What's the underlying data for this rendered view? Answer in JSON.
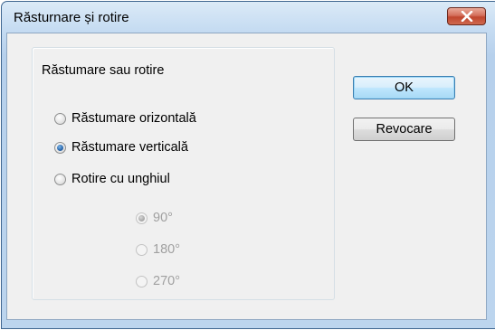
{
  "window": {
    "title": "Răsturnare și rotire"
  },
  "group": {
    "legend": "Răstumare sau rotire",
    "options": [
      {
        "label": "Răstumare orizontală",
        "checked": false
      },
      {
        "label": "Răstumare verticală",
        "checked": true
      },
      {
        "label": "Rotire cu unghiul",
        "checked": false
      }
    ],
    "angles": [
      {
        "label": "90°",
        "checked": true,
        "disabled": true
      },
      {
        "label": "180°",
        "checked": false,
        "disabled": true
      },
      {
        "label": "270°",
        "checked": false,
        "disabled": true
      }
    ]
  },
  "buttons": {
    "ok": "OK",
    "cancel": "Revocare"
  },
  "icons": {
    "close": "close-icon"
  }
}
